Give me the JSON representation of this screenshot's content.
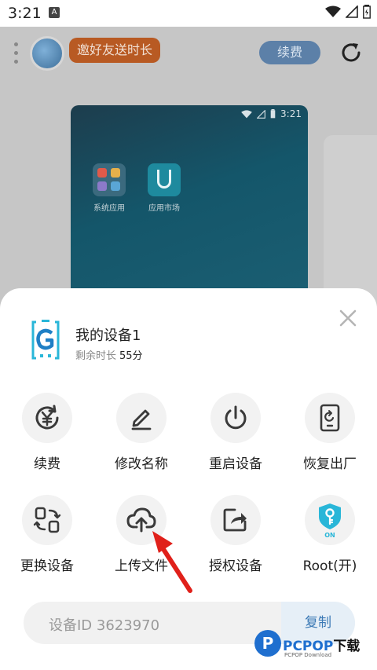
{
  "status_bar": {
    "time": "3:21",
    "notification_letter": "A"
  },
  "background": {
    "invite_label": "邀好友送时长",
    "renew_label": "续费",
    "preview": {
      "time": "3:21",
      "apps": [
        {
          "label": "系统应用",
          "icon": "system-apps-folder-icon"
        },
        {
          "label": "应用市场",
          "icon": "app-market-icon"
        }
      ]
    }
  },
  "sheet": {
    "device_name": "我的设备1",
    "remaining_label": "剩余时长",
    "remaining_value": "55分",
    "actions": [
      {
        "label": "续费",
        "icon": "renew-yen-icon"
      },
      {
        "label": "修改名称",
        "icon": "edit-pen-icon"
      },
      {
        "label": "重启设备",
        "icon": "power-icon"
      },
      {
        "label": "恢复出厂",
        "icon": "factory-reset-phone-icon"
      },
      {
        "label": "更换设备",
        "icon": "swap-device-icon"
      },
      {
        "label": "上传文件",
        "icon": "upload-cloud-icon"
      },
      {
        "label": "授权设备",
        "icon": "share-authorize-icon"
      },
      {
        "label": "Root(开)",
        "icon": "root-key-shield-icon",
        "badge": "ON"
      }
    ],
    "device_id_text": "设备ID 3623970",
    "copy_label": "复制"
  },
  "watermark": {
    "brand": "PCPOP",
    "brand_suffix": "下载",
    "sub": "PCPOP Download",
    "logo_letter": "P"
  },
  "colors": {
    "accent": "#3b79b5",
    "invite_bg": "#b85a23",
    "cyan": "#29b6d8",
    "arrow": "#e0201a"
  }
}
